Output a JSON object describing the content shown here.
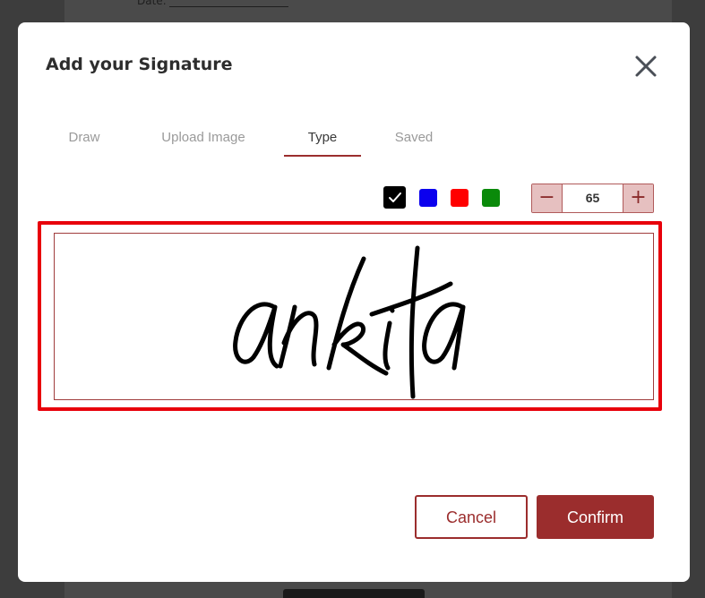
{
  "background": {
    "date_label": "Date:"
  },
  "modal": {
    "title": "Add your Signature",
    "close_icon": "close-icon"
  },
  "tabs": [
    {
      "label": "Draw",
      "active": false
    },
    {
      "label": "Upload Image",
      "active": false
    },
    {
      "label": "Type",
      "active": true
    },
    {
      "label": "Saved",
      "active": false
    }
  ],
  "colors": {
    "options": [
      {
        "name": "black",
        "hex": "#000000",
        "selected": true
      },
      {
        "name": "blue",
        "hex": "#0b00ee",
        "selected": false
      },
      {
        "name": "red",
        "hex": "#ff0000",
        "selected": false
      },
      {
        "name": "green",
        "hex": "#0a8a0a",
        "selected": false
      }
    ],
    "accent": "#9b2d2d",
    "highlight": "#e8000b"
  },
  "font_size_stepper": {
    "minus_label": "−",
    "value": "65",
    "plus_label": "+"
  },
  "signature": {
    "text": "ankita"
  },
  "actions": {
    "cancel_label": "Cancel",
    "confirm_label": "Confirm"
  }
}
